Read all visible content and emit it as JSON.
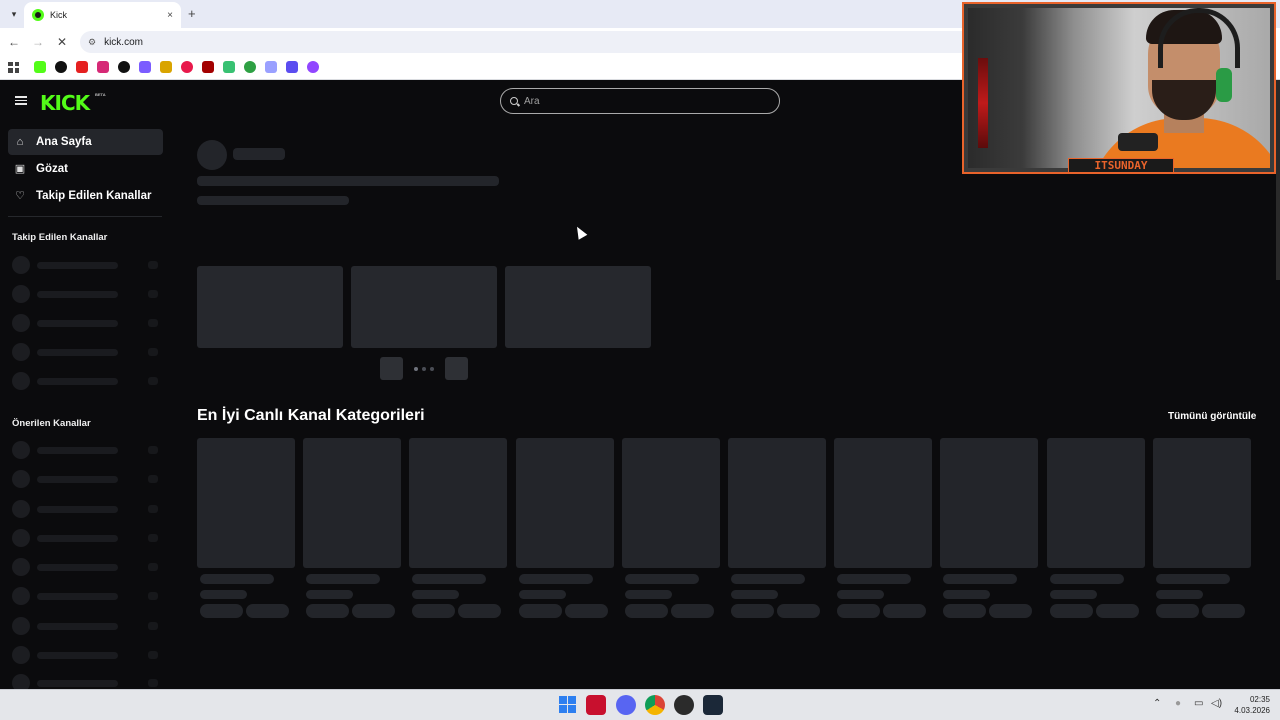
{
  "browser": {
    "tab_title": "Kick",
    "url": "kick.com",
    "tab_close": "×",
    "new_tab": "+",
    "back": "←",
    "forward": "→",
    "stop": "✕",
    "bookmark_colors": [
      "#53fc18",
      "#111111",
      "#e52020",
      "#d62976",
      "#111111",
      "#7b5cff",
      "#d9a400",
      "#e8194b",
      "#a30000",
      "#38c172",
      "#2ea043",
      "#9aa0ff",
      "#5b4df0",
      "#9146ff"
    ]
  },
  "site": {
    "logo": "KICK",
    "logo_badge": "BETA",
    "search": {
      "placeholder": "Ara"
    },
    "nav": {
      "home": "Ana Sayfa",
      "browse": "Gözat",
      "following": "Takip Edilen Kanallar"
    },
    "sidebar": {
      "following_heading": "Takip Edilen Kanallar",
      "recommended_heading": "Önerilen Kanallar"
    },
    "categories": {
      "title": "En İyi Canlı Kanal Kategorileri",
      "see_all": "Tümünü görüntüle"
    },
    "accent_color": "#53fc18"
  },
  "webcam": {
    "label": "ITSUNDAY",
    "frame_color": "#e8632b"
  },
  "taskbar": {
    "time": "02:35",
    "date": "4.03.2026"
  }
}
